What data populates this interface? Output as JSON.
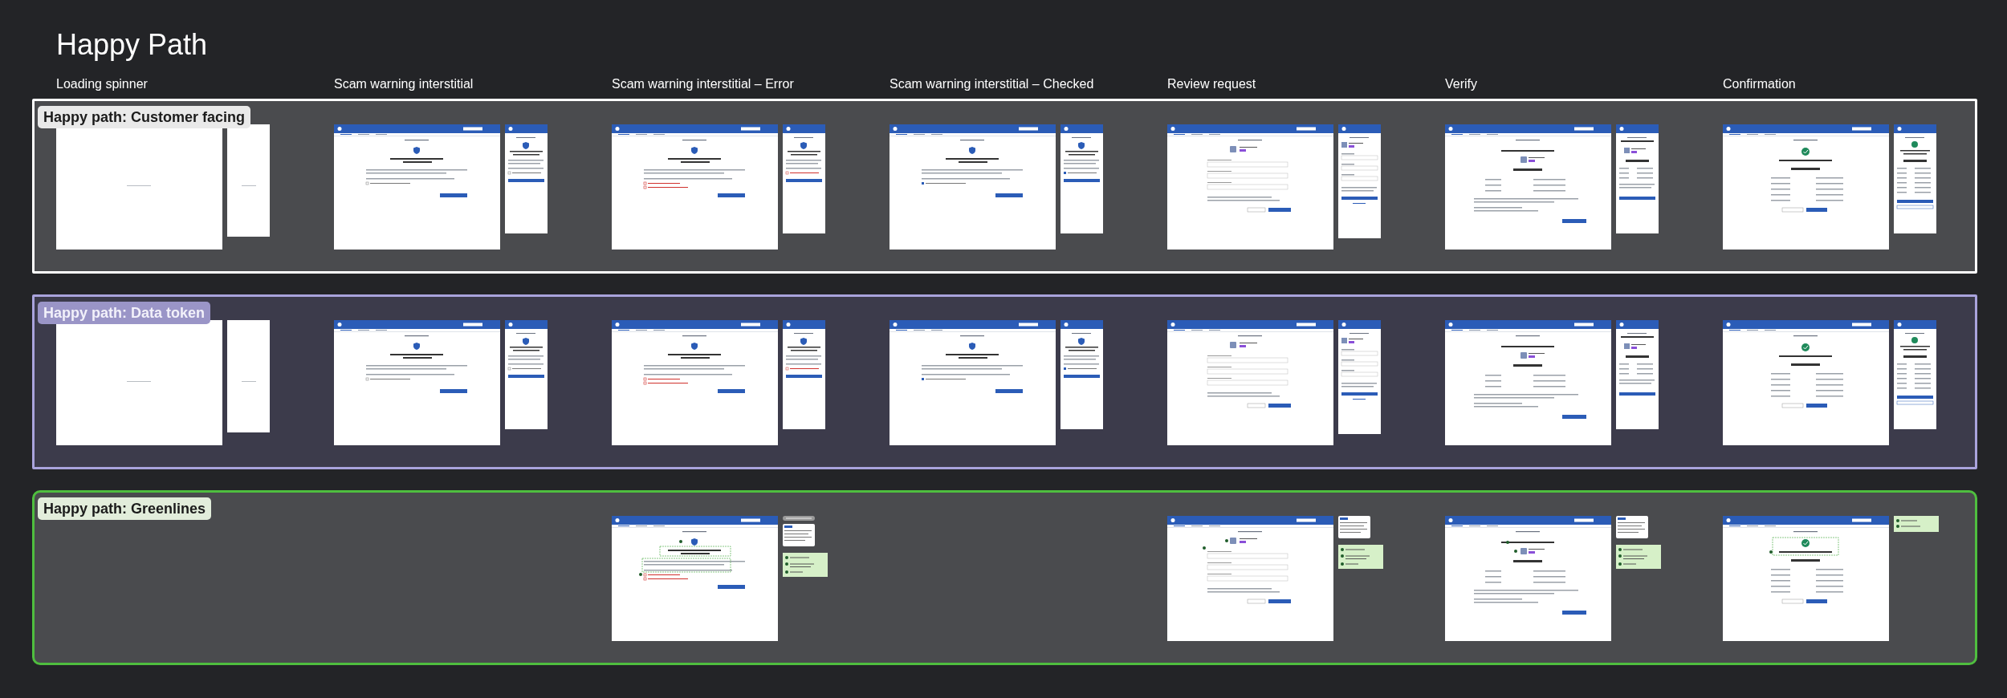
{
  "title": "Happy Path",
  "columns": [
    "Loading spinner",
    "Scam warning interstitial",
    "Scam warning interstitial – Error",
    "Scam warning interstitial – Checked",
    "Review request",
    "Verify",
    "Confirmation"
  ],
  "sections": [
    {
      "label": "Happy path: Customer facing",
      "kind": "customer",
      "cells": [
        {
          "kind": "spinner",
          "mobile": true
        },
        {
          "kind": "warning",
          "mobile": true
        },
        {
          "kind": "warning_error",
          "mobile": true
        },
        {
          "kind": "warning_checked",
          "mobile": true
        },
        {
          "kind": "review",
          "mobile": true
        },
        {
          "kind": "verify",
          "mobile": true
        },
        {
          "kind": "confirm",
          "mobile": true
        }
      ]
    },
    {
      "label": "Happy path: Data token",
      "kind": "token",
      "cells": [
        {
          "kind": "spinner",
          "mobile": true
        },
        {
          "kind": "warning",
          "mobile": true
        },
        {
          "kind": "warning_error",
          "mobile": true
        },
        {
          "kind": "warning_checked",
          "mobile": true
        },
        {
          "kind": "review",
          "mobile": true
        },
        {
          "kind": "verify",
          "mobile": true
        },
        {
          "kind": "confirm",
          "mobile": true
        }
      ]
    },
    {
      "label": "Happy path: Greenlines",
      "kind": "greenlines",
      "cells": [
        {
          "kind": "empty"
        },
        {
          "kind": "empty"
        },
        {
          "kind": "warning_error",
          "notes": true
        },
        {
          "kind": "empty"
        },
        {
          "kind": "review",
          "notes": true
        },
        {
          "kind": "verify",
          "notes": true
        },
        {
          "kind": "confirm",
          "notes": true
        }
      ]
    }
  ]
}
